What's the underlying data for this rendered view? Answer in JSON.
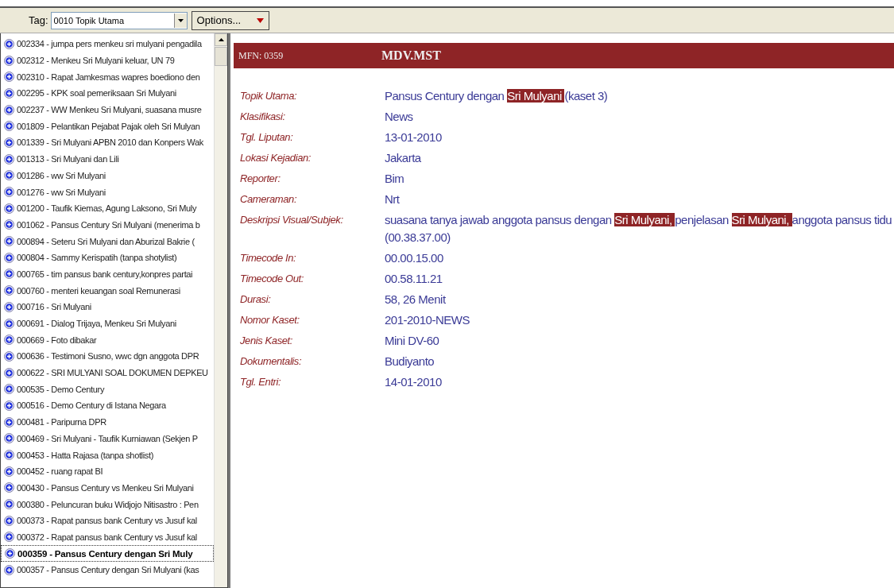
{
  "toolbar": {
    "tag_label": "Tag:",
    "tag_value": "0010 Topik Utama",
    "options_label": "Options..."
  },
  "records": [
    {
      "label": "002334 - jumpa pers menkeu sri mulyani pengadila",
      "selected": false
    },
    {
      "label": "002312 - Menkeu Sri Mulyani keluar, UN 79",
      "selected": false
    },
    {
      "label": "002310 - Rapat Jamkesmas wapres boediono den",
      "selected": false
    },
    {
      "label": "002295 - KPK soal pemeriksaan Sri Mulyani",
      "selected": false
    },
    {
      "label": "002237 - WW Menkeu Sri Mulyani, suasana musre",
      "selected": false
    },
    {
      "label": "001809 - Pelantikan Pejabat Pajak oleh Sri Mulyan",
      "selected": false
    },
    {
      "label": "001339 - Sri Mulyani APBN 2010 dan Konpers Wak",
      "selected": false
    },
    {
      "label": "001313 - Sri Mulyani dan Lili",
      "selected": false
    },
    {
      "label": "001286 - ww Sri Mulyani",
      "selected": false
    },
    {
      "label": "001276 - ww Sri Mulyani",
      "selected": false
    },
    {
      "label": "001200 - Taufik Kiemas, Agung Laksono, Sri Muly",
      "selected": false
    },
    {
      "label": "001062 - Pansus Century Sri Mulyani (menerima b",
      "selected": false
    },
    {
      "label": "000894 - Seteru Sri Mulyani dan Aburizal Bakrie (",
      "selected": false
    },
    {
      "label": "000804 - Sammy Kerispatih (tanpa shotylist)",
      "selected": false
    },
    {
      "label": "000765 - tim pansus bank century,konpres partai",
      "selected": false
    },
    {
      "label": "000760 - menteri keuangan soal Remunerasi",
      "selected": false
    },
    {
      "label": "000716 - Sri Mulyani",
      "selected": false
    },
    {
      "label": "000691 - Dialog Trijaya, Menkeu Sri Mulyani",
      "selected": false
    },
    {
      "label": "000669 - Foto dibakar",
      "selected": false
    },
    {
      "label": "000636 - Testimoni Susno, wwc dgn anggota DPR",
      "selected": false
    },
    {
      "label": "000622 - SRI MULYANI SOAL DOKUMEN DEPKEU",
      "selected": false
    },
    {
      "label": "000535 - Demo Century",
      "selected": false
    },
    {
      "label": "000516 - Demo Century di Istana Negara",
      "selected": false
    },
    {
      "label": "000481 - Paripurna DPR",
      "selected": false
    },
    {
      "label": "000469 - Sri Mulyani - Taufik Kurniawan (Sekjen P",
      "selected": false
    },
    {
      "label": "000453 - Hatta Rajasa (tanpa shotlist)",
      "selected": false
    },
    {
      "label": "000452 - ruang rapat BI",
      "selected": false
    },
    {
      "label": "000430 - Pansus Century vs Menkeu Sri Mulyani",
      "selected": false
    },
    {
      "label": "000380 - Peluncuran buku Widjojo Nitisastro : Pen",
      "selected": false
    },
    {
      "label": "000373 - Rapat pansus bank Century vs Jusuf kal",
      "selected": false
    },
    {
      "label": "000372 - Rapat pansus bank Century vs Jusuf kal",
      "selected": false
    },
    {
      "label": "000359 - Pansus Century dengan Sri Muly",
      "selected": true
    },
    {
      "label": "000357 - Pansus Century dengan Sri Mulyani (kas",
      "selected": false
    }
  ],
  "detail": {
    "mfn": "MFN: 0359",
    "database": "MDV.MST",
    "fields": [
      {
        "label": "Topik Utama:",
        "lines": [
          [
            {
              "text": "Pansus Century dengan ",
              "highlighted": false
            },
            {
              "text": "Sri Mulyani ",
              "highlighted": true
            },
            {
              "text": "(kaset 3)",
              "highlighted": false
            }
          ]
        ]
      },
      {
        "label": "Klasifikasi:",
        "lines": [
          [
            {
              "text": "News",
              "highlighted": false
            }
          ]
        ]
      },
      {
        "label": "Tgl. Liputan:",
        "lines": [
          [
            {
              "text": "13-01-2010",
              "highlighted": false
            }
          ]
        ]
      },
      {
        "label": "Lokasi Kejadian:",
        "lines": [
          [
            {
              "text": "Jakarta",
              "highlighted": false
            }
          ]
        ]
      },
      {
        "label": "Reporter:",
        "lines": [
          [
            {
              "text": "Bim",
              "highlighted": false
            }
          ]
        ]
      },
      {
        "label": "Cameraman:",
        "lines": [
          [
            {
              "text": "Nrt",
              "highlighted": false
            }
          ]
        ]
      },
      {
        "label": "Deskripsi Visual/Subjek:",
        "lines": [
          [
            {
              "text": "suasana tanya jawab anggota pansus dengan ",
              "highlighted": false
            },
            {
              "text": "Sri Mulyani, ",
              "highlighted": true
            },
            {
              "text": "penjelasan ",
              "highlighted": false
            },
            {
              "text": "Sri Mulyani, ",
              "highlighted": true
            },
            {
              "text": "anggota pansus tidu",
              "highlighted": false
            }
          ],
          [
            {
              "text": "(00.38.37.00)",
              "highlighted": false
            }
          ]
        ]
      },
      {
        "label": "Timecode In:",
        "lines": [
          [
            {
              "text": "00.00.15.00",
              "highlighted": false
            }
          ]
        ]
      },
      {
        "label": "Timecode Out:",
        "lines": [
          [
            {
              "text": "00.58.11.21",
              "highlighted": false
            }
          ]
        ]
      },
      {
        "label": "Durasi:",
        "lines": [
          [
            {
              "text": "58, 26 Menit",
              "highlighted": false
            }
          ]
        ]
      },
      {
        "label": "Nomor Kaset:",
        "lines": [
          [
            {
              "text": "201-2010-NEWS",
              "highlighted": false
            }
          ]
        ]
      },
      {
        "label": "Jenis Kaset:",
        "lines": [
          [
            {
              "text": "Mini DV-60",
              "highlighted": false
            }
          ]
        ]
      },
      {
        "label": "Dokumentalis:",
        "lines": [
          [
            {
              "text": "Budiyanto",
              "highlighted": false
            }
          ]
        ]
      },
      {
        "label": "Tgl. Entri:",
        "lines": [
          [
            {
              "text": "14-01-2010",
              "highlighted": false
            }
          ]
        ]
      }
    ]
  }
}
